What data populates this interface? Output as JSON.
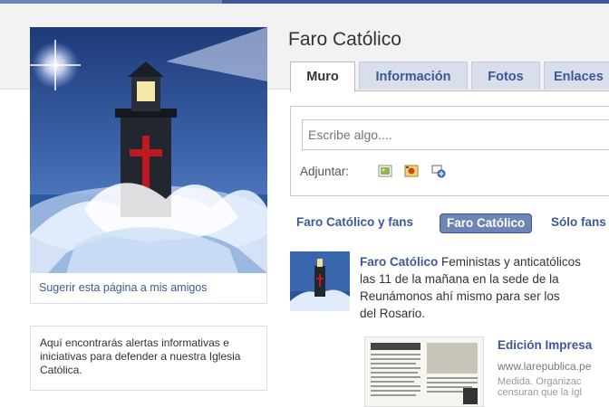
{
  "page": {
    "title": "Faro Católico"
  },
  "profile": {
    "picture_alt": "lighthouse-with-cross",
    "suggest_link": "Sugerir esta página a mis amigos",
    "info_text": "Aquí encontrarás alertas informativas e iniciativas para defender a nuestra Iglesia Católica."
  },
  "tabs": [
    "Muro",
    "Información",
    "Fotos",
    "Enlaces"
  ],
  "composer": {
    "placeholder": "Escribe algo....",
    "attach_label": "Adjuntar:",
    "attach_icons": [
      "photo-icon",
      "video-icon",
      "link-icon"
    ]
  },
  "filters": [
    "Faro Católico y fans",
    "Faro Católico",
    "Sólo fans"
  ],
  "post": {
    "author": "Faro Católico",
    "lines": [
      " Feministas y anticatólicos",
      "las 11 de la mañana en la sede de la",
      "Reunámonos ahí mismo para ser los",
      "del Rosario."
    ],
    "link_title": "Edición Impresa",
    "link_url": "www.larepublica.pe",
    "link_desc": [
      "Medida. Organizac",
      "censuran que la Igl"
    ]
  },
  "colors": {
    "brand": "#3b5998",
    "tab_bg": "#d8dfea",
    "selected_filter": "#6d84b4"
  }
}
